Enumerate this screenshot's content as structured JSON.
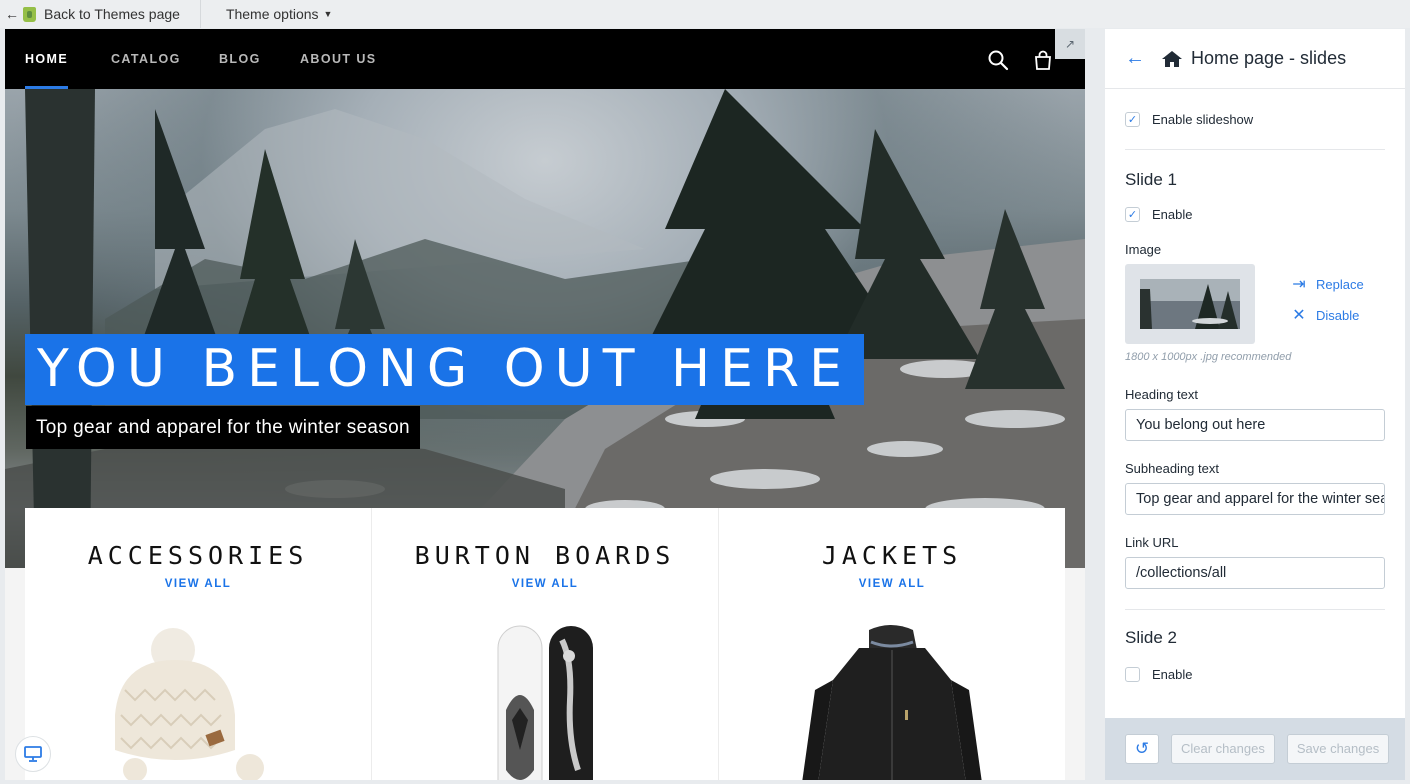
{
  "topbar": {
    "back_label": "Back to Themes page",
    "theme_options_label": "Theme options"
  },
  "nav": {
    "items": [
      {
        "label": "HOME",
        "active": true
      },
      {
        "label": "CATALOG",
        "active": false
      },
      {
        "label": "BLOG",
        "active": false
      },
      {
        "label": "ABOUT US",
        "active": false
      }
    ],
    "icons": [
      "search-icon",
      "cart-icon"
    ]
  },
  "hero": {
    "heading": "YOU BELONG OUT HERE",
    "subheading": "Top gear and apparel for the winter season"
  },
  "collections": [
    {
      "title": "ACCESSORIES",
      "link": "VIEW ALL",
      "image": "beanie"
    },
    {
      "title": "BURTON BOARDS",
      "link": "VIEW ALL",
      "image": "snowboards"
    },
    {
      "title": "JACKETS",
      "link": "VIEW ALL",
      "image": "jacket"
    }
  ],
  "panel": {
    "title": "Home page - slides",
    "enable_slideshow": {
      "label": "Enable slideshow",
      "checked": true
    },
    "slide1": {
      "title": "Slide 1",
      "enable": {
        "label": "Enable",
        "checked": true
      },
      "image_label": "Image",
      "replace_label": "Replace",
      "disable_label": "Disable",
      "image_hint": "1800 x 1000px .jpg recommended",
      "heading_label": "Heading text",
      "heading_value": "You belong out here",
      "subheading_label": "Subheading text",
      "subheading_value": "Top gear and apparel for the winter season",
      "link_label": "Link URL",
      "link_value": "/collections/all"
    },
    "slide2": {
      "title": "Slide 2",
      "enable": {
        "label": "Enable",
        "checked": false
      }
    },
    "footer": {
      "clear_label": "Clear changes",
      "save_label": "Save changes"
    }
  },
  "colors": {
    "accent": "#1a73e8",
    "link": "#2c7be5",
    "nav_bg": "#000000"
  }
}
